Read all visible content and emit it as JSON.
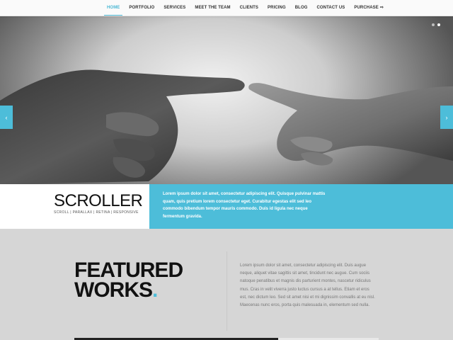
{
  "nav": {
    "items": [
      {
        "label": "HOME",
        "active": true
      },
      {
        "label": "PORTFOLIO",
        "active": false
      },
      {
        "label": "SERVICES",
        "active": false
      },
      {
        "label": "MEET THE TEAM",
        "active": false
      },
      {
        "label": "CLIENTS",
        "active": false
      },
      {
        "label": "PRICING",
        "active": false
      },
      {
        "label": "BLOG",
        "active": false
      },
      {
        "label": "CONTACT US",
        "active": false
      },
      {
        "label": "PURCHASE",
        "active": false,
        "icon": "external-arrow-icon"
      }
    ]
  },
  "hero": {
    "image": "hands-touching-photo",
    "slider_dots": 2,
    "left_arrow_icon": "chevron-left-icon",
    "right_arrow_icon": "chevron-right-icon"
  },
  "brand": {
    "logo": "SCROLLER",
    "tagline": "SCROLL | PARALLAX | RETINA | RESPONSIVE"
  },
  "intro": {
    "text": "Lorem ipsum dolor sit amet, consectetur adipiscing elit. Quisque pulvinar mattis quam, quis pretium lorem consectetur eget. Curabitur egestas elit sed leo commodo bibendum tempor mauris commodo. Duis id ligula nec neque fermentum gravida."
  },
  "featured": {
    "title_line1": "FEATURED",
    "title_line2": "WORKS",
    "title_dot": ".",
    "description": "Lorem ipsum dolor sit amet, consectetur adipiscing elit. Duis augue neque, aliquet vitae sagittis sit amet, tincidunt nec augue. Cum sociis natoque penatibus et magnis dis parturient montes, nascetur ridiculus mus. Cras in velit viverra justo luctus cursus a at tellus. Etiam et eros est, nec dictum leo. Sed sit amet nisi et mi dignissim convallis at eu nisl. Maecenas nunc eros, porta quis malesuada in, elementum sed nulla."
  },
  "colors": {
    "accent": "#4dbdd9",
    "nav_bg": "#fafafa",
    "page_bg": "#d6d6d6"
  }
}
